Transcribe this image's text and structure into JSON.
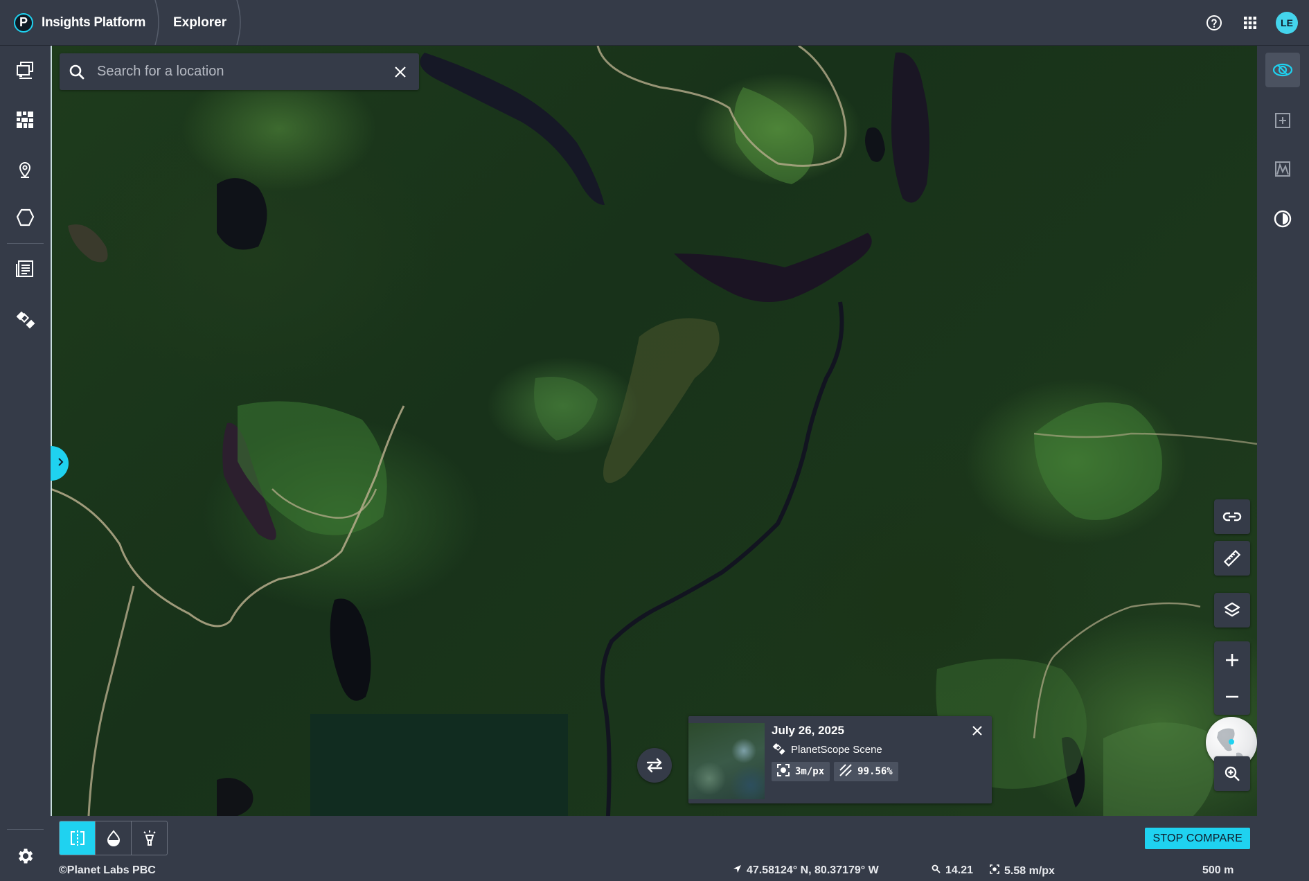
{
  "app": {
    "brand_letter": "P",
    "title": "Insights Platform",
    "section": "Explorer",
    "user_initials": "LE",
    "accent": "#1fd2f0"
  },
  "top_icons": [
    "help-circle-icon",
    "apps-grid-icon"
  ],
  "left_sidebar": {
    "items": [
      "stacked-images-icon",
      "mosaic-grid-icon",
      "location-pin-icon",
      "polygon-icon",
      "feed-list-icon",
      "satellite-icon"
    ],
    "footer": "gear-icon"
  },
  "right_sidebar": {
    "items": [
      "imagery-orbit-icon",
      "add-image-icon",
      "spectral-chart-icon",
      "contrast-icon"
    ],
    "active": "imagery-orbit-icon"
  },
  "search": {
    "placeholder": "Search for a location",
    "value": ""
  },
  "scene_card": {
    "date": "July 26, 2025",
    "type": "PlanetScope Scene",
    "resolution": "3m/px",
    "coverage": "99.56%"
  },
  "map_tools": [
    "link-icon",
    "ruler-icon",
    "layers-icon",
    "zoom-in-icon",
    "zoom-out-icon",
    "globe-icon",
    "zoom-area-icon"
  ],
  "bottom_toolbar": {
    "modes": [
      "split-compare-icon",
      "swipe-opacity-icon",
      "spotlight-icon"
    ],
    "active_mode": "split-compare-icon",
    "stop_compare_label": "STOP COMPARE"
  },
  "status": {
    "copyright": "©Planet Labs PBC",
    "coordinates": "47.58124° N, 80.37179° W",
    "zoom": "14.21",
    "resolution": "5.58 m/px",
    "scale": "500 m"
  }
}
